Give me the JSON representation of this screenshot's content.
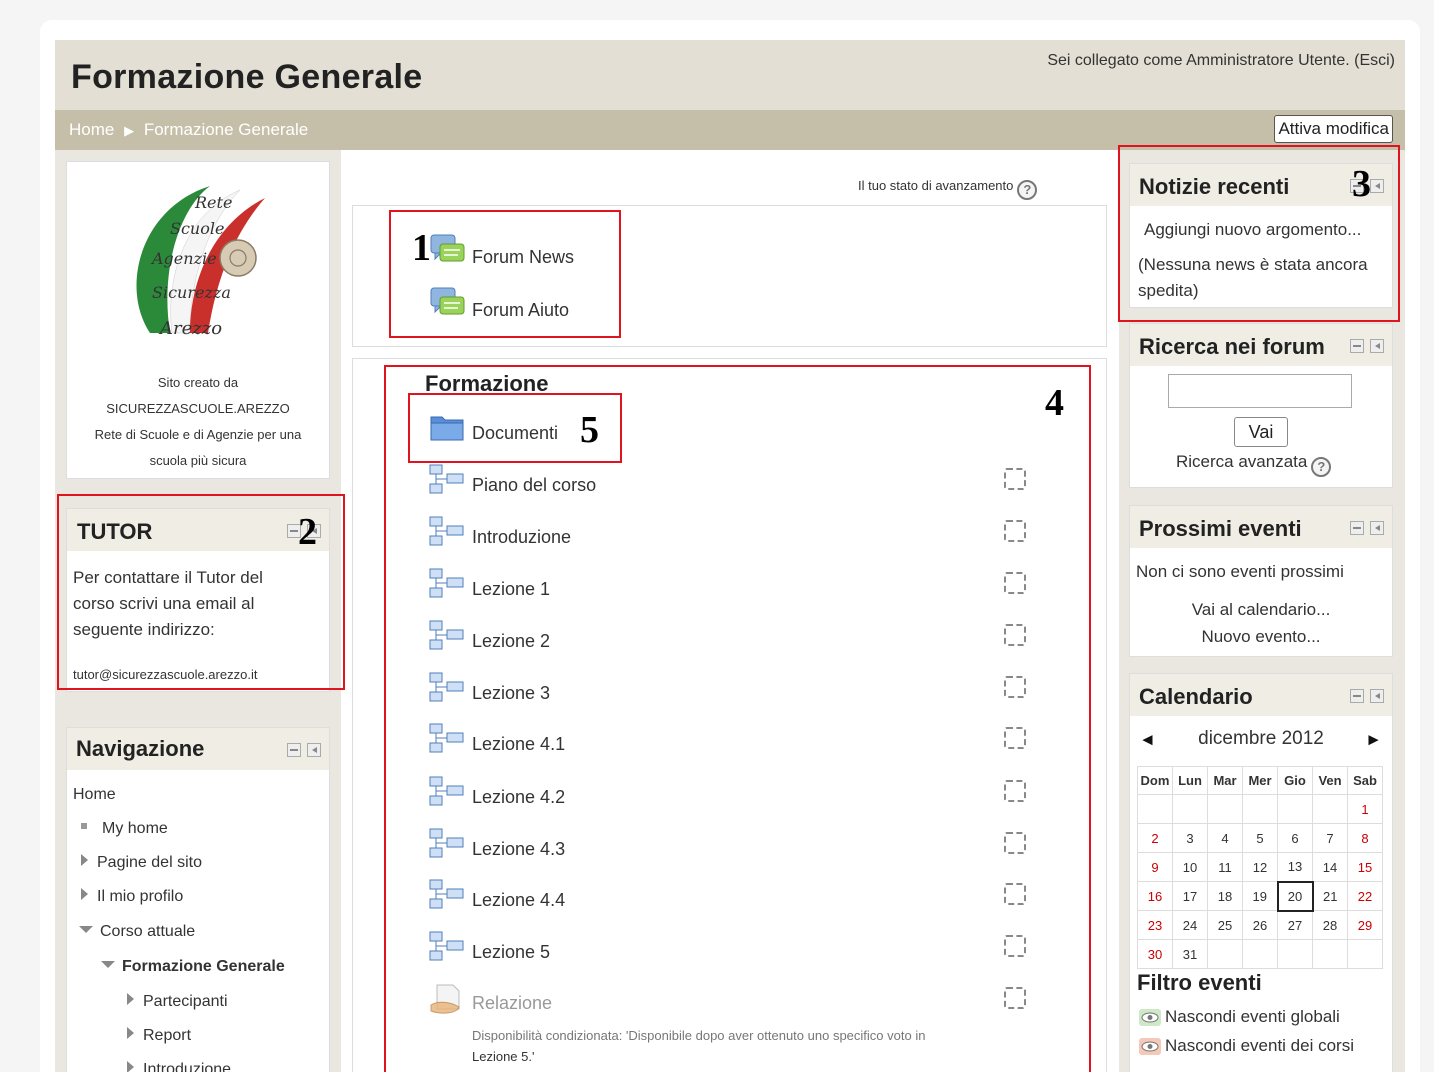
{
  "header": {
    "title": "Formazione Generale",
    "login_info": "Sei collegato come Amministratore Utente. (Esci)"
  },
  "breadcrumb": {
    "home": "Home",
    "separator": "▶",
    "current": "Formazione Generale"
  },
  "edit_button": "Attiva modifica",
  "left": {
    "logo_text": [
      "Rete",
      "Scuole",
      "Agenzie",
      "Sicurezza",
      "Arezzo"
    ],
    "site_info": {
      "line1": "Sito creato da",
      "line2": "SICUREZZASCUOLE.AREZZO",
      "line3": "Rete di Scuole e di Agenzie per una",
      "line4": "scuola più sicura"
    },
    "tutor": {
      "title": "TUTOR",
      "text": "Per contattare il Tutor del corso scrivi una email al seguente indirizzo:",
      "email": "tutor@sicurezzascuole.arezzo.it"
    },
    "navigation": {
      "title": "Navigazione",
      "items": [
        {
          "label": "Home"
        },
        {
          "label": "My home"
        },
        {
          "label": "Pagine del sito"
        },
        {
          "label": "Il mio profilo"
        },
        {
          "label": "Corso attuale"
        },
        {
          "label": "Formazione Generale"
        },
        {
          "label": "Partecipanti"
        },
        {
          "label": "Report"
        },
        {
          "label": "Introduzione"
        }
      ]
    }
  },
  "center": {
    "progress_label": "Il tuo stato di avanzamento",
    "top_section": {
      "activities": [
        {
          "label": "Forum News",
          "icon": "forum-icon"
        },
        {
          "label": "Forum Aiuto",
          "icon": "forum-icon"
        }
      ]
    },
    "section": {
      "title": "Formazione",
      "folder": {
        "label": "Documenti",
        "icon": "folder-icon"
      },
      "lessons": [
        {
          "label": "Piano del corso"
        },
        {
          "label": "Introduzione"
        },
        {
          "label": "Lezione 1"
        },
        {
          "label": "Lezione 2"
        },
        {
          "label": "Lezione 3"
        },
        {
          "label": "Lezione 4.1"
        },
        {
          "label": "Lezione 4.2"
        },
        {
          "label": "Lezione 4.3"
        },
        {
          "label": "Lezione 4.4"
        },
        {
          "label": "Lezione 5"
        }
      ],
      "assignment": {
        "label": "Relazione",
        "condition_line1": "Disponibilità condizionata: 'Disponibile dopo aver ottenuto uno specifico voto in",
        "condition_line2": "Lezione 5.'"
      }
    }
  },
  "right": {
    "news": {
      "title": "Notizie recenti",
      "add_link": "Aggiungi nuovo argomento...",
      "none_text": "(Nessuna news è stata ancora spedita)"
    },
    "search": {
      "title": "Ricerca nei forum",
      "button": "Vai",
      "advanced": "Ricerca avanzata"
    },
    "events": {
      "title": "Prossimi eventi",
      "none_text": "Non ci sono eventi prossimi",
      "calendar_link": "Vai al calendario...",
      "new_event_link": "Nuovo evento..."
    },
    "calendar": {
      "title": "Calendario",
      "prev": "◄",
      "next": "►",
      "month": "dicembre 2012",
      "weekdays": [
        "Dom",
        "Lun",
        "Mar",
        "Mer",
        "Gio",
        "Ven",
        "Sab"
      ],
      "weeks": [
        [
          "",
          "",
          "",
          "",
          "",
          "",
          "1"
        ],
        [
          "2",
          "3",
          "4",
          "5",
          "6",
          "7",
          "8"
        ],
        [
          "9",
          "10",
          "11",
          "12",
          "13",
          "14",
          "15"
        ],
        [
          "16",
          "17",
          "18",
          "19",
          "20",
          "21",
          "22"
        ],
        [
          "23",
          "24",
          "25",
          "26",
          "27",
          "28",
          "29"
        ],
        [
          "30",
          "31",
          "",
          "",
          "",
          "",
          ""
        ]
      ],
      "today": "20",
      "filter_title": "Filtro eventi",
      "filters": [
        {
          "label": "Nascondi eventi globali",
          "color": "#cfe8c8"
        },
        {
          "label": "Nascondi eventi dei corsi",
          "color": "#f6c8b8"
        }
      ]
    }
  },
  "callouts": [
    "1",
    "2",
    "3",
    "4",
    "5"
  ],
  "colors": {
    "header_bg": "#e3dfd4",
    "navbar_bg": "#c5bfa9",
    "page_bg": "#eae7e0",
    "callout_red": "#e0141e"
  }
}
